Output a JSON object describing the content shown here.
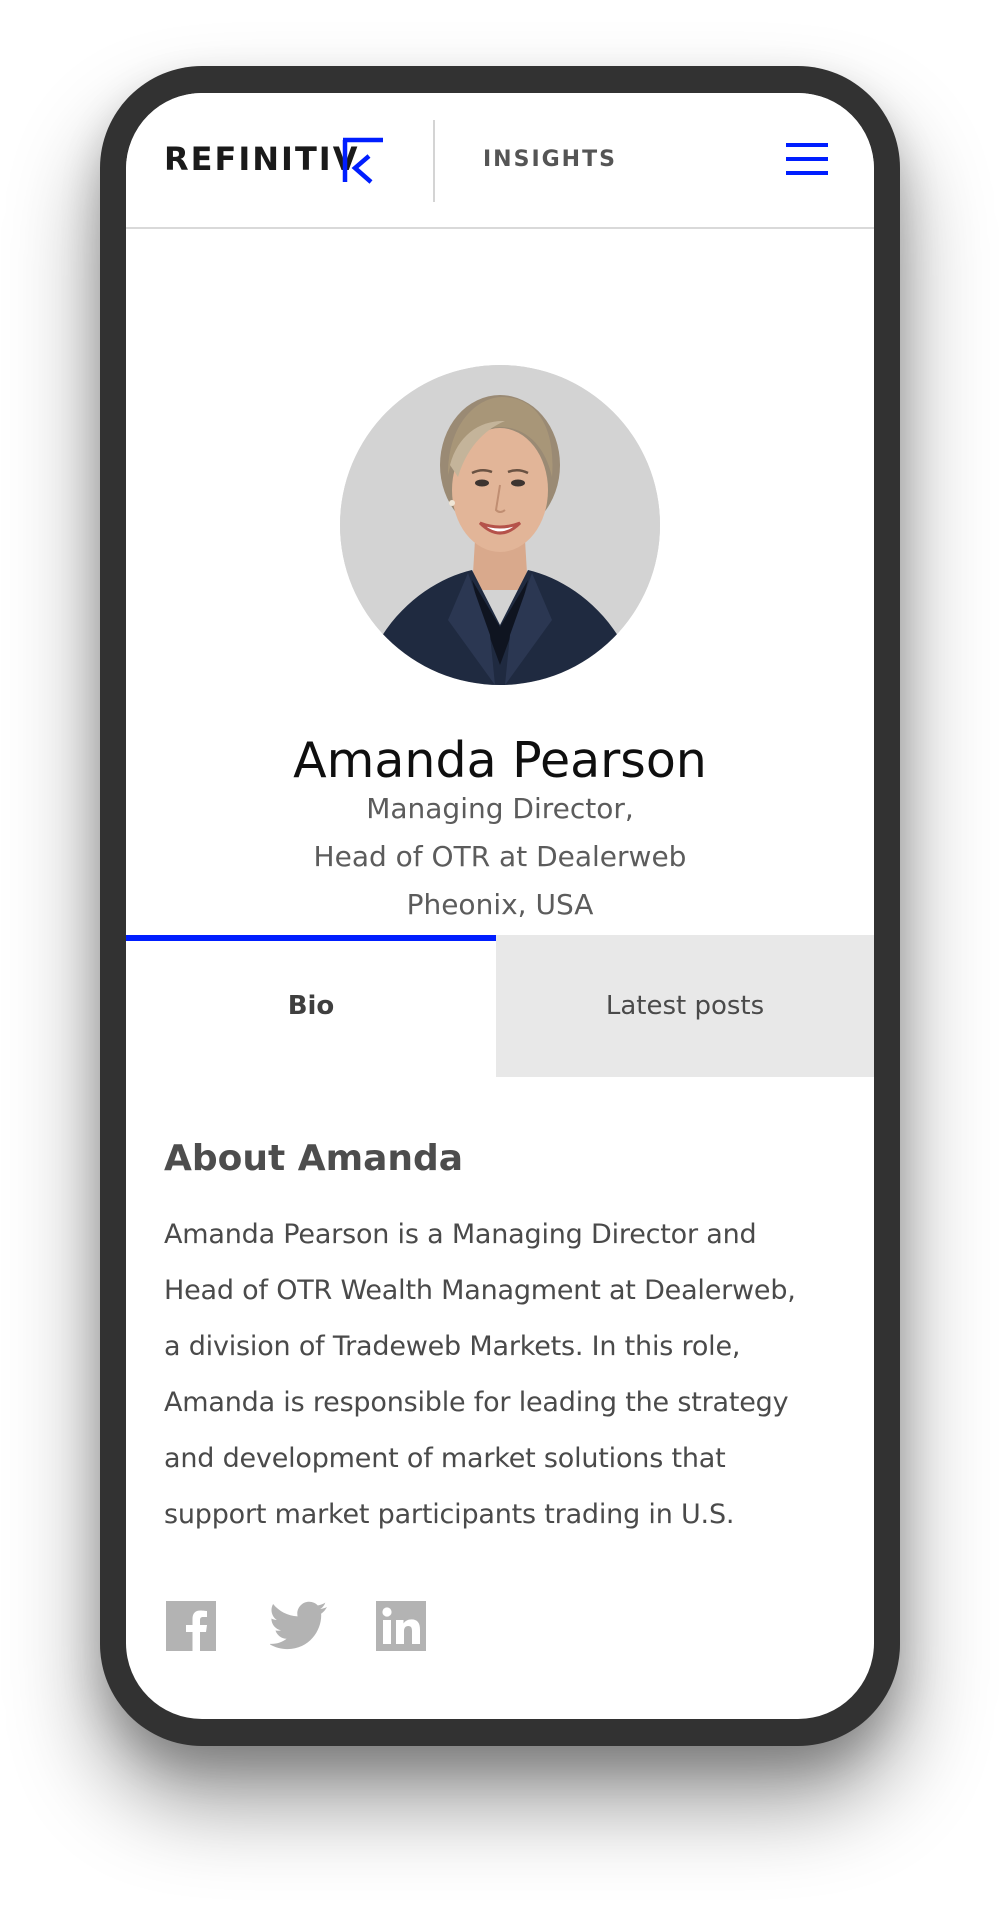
{
  "header": {
    "brand": "REFINITIV",
    "section": "INSIGHTS",
    "menu_icon": "hamburger-menu-icon",
    "accent_color": "#001eff"
  },
  "profile": {
    "name": "Amanda Pearson",
    "role_lines": [
      "Managing Director,",
      "Head of OTR at Dealerweb",
      "Pheonix, USA"
    ]
  },
  "tabs": [
    {
      "label": "Bio",
      "active": true
    },
    {
      "label": "Latest posts",
      "active": false
    }
  ],
  "bio": {
    "title": "About Amanda",
    "lines": [
      "Amanda Pearson is a Managing Director and",
      "Head of OTR Wealth Managment at Dealerweb,",
      "a division of Tradeweb Markets. In this role,",
      "Amanda is responsible for leading the strategy",
      "and development of market solutions that",
      "support market participants trading in U.S."
    ]
  },
  "social": [
    "facebook-icon",
    "twitter-icon",
    "linkedin-icon"
  ]
}
